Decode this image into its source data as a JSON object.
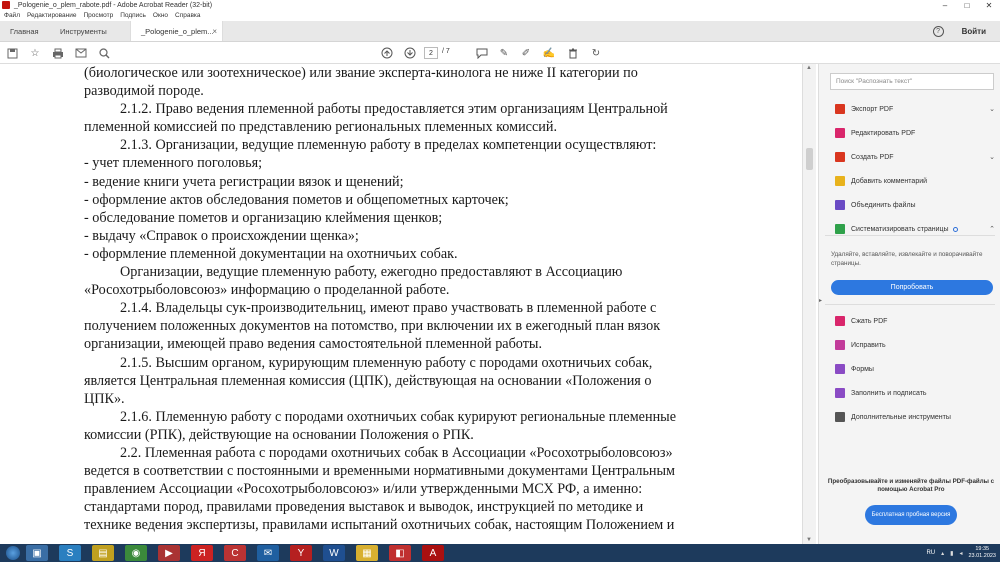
{
  "window": {
    "title": "_Pologenie_o_plem_rabote.pdf - Adobe Acrobat Reader (32-bit)",
    "controls": [
      "–",
      "□",
      "✕"
    ]
  },
  "menu": [
    "Файл",
    "Редактирование",
    "Просмотр",
    "Подпись",
    "Окно",
    "Справка"
  ],
  "tabs": {
    "home": "Главная",
    "tools": "Инструменты",
    "document": "_Pologenie_o_plem...",
    "sign_in": "Войти",
    "help": "?"
  },
  "toolbar": {
    "current_page": "2",
    "total_pages": "/ 7"
  },
  "document": {
    "lines": [
      {
        "text": "(биологическое или зоотехническое) или звание эксперта-кинолога не ниже II категории по",
        "style": "j"
      },
      {
        "text": "разводимой породе.",
        "style": ""
      },
      {
        "text": "2.1.2. Право ведения племенной работы предоставляется этим организациям Центральной",
        "style": "j ind"
      },
      {
        "text": "племенной комиссией по представлению региональных племенных комиссий.",
        "style": ""
      },
      {
        "text": "2.1.3. Организации, ведущие племенную работу в пределах компетенции осуществляют:",
        "style": "ind"
      },
      {
        "text": "- учет племенного поголовья;",
        "style": ""
      },
      {
        "text": "- ведение книги учета регистрации вязок и щенений;",
        "style": ""
      },
      {
        "text": "- оформление актов обследования пометов и общепометных карточек;",
        "style": ""
      },
      {
        "text": "- обследование пометов и организацию клеймения щенков;",
        "style": ""
      },
      {
        "text": "- выдачу «Справок о происхождении щенка»;",
        "style": ""
      },
      {
        "text": "- оформление племенной документации на охотничьих собак.",
        "style": ""
      },
      {
        "text": "Организации, ведущие племенную работу, ежегодно предоставляют в Ассоциацию",
        "style": "j ind"
      },
      {
        "text": "«Росохотрыболовсоюз» информацию о проделанной работе.",
        "style": ""
      },
      {
        "text": "2.1.4. Владельцы сук-производительниц, имеют право участвовать в племенной работе с",
        "style": "j ind"
      },
      {
        "text": "получением положенных документов на потомство, при включении их в ежегодный план вязок",
        "style": "j"
      },
      {
        "text": "организации, имеющей право ведения самостоятельной племенной работы.",
        "style": ""
      },
      {
        "text": "2.1.5. Высшим органом, курирующим племенную работу с породами охотничьих собак,",
        "style": "j ind"
      },
      {
        "text": "является Центральная племенная комиссия (ЦПК), действующая на основании «Положения о",
        "style": "j"
      },
      {
        "text": "ЦПК».",
        "style": ""
      },
      {
        "text": "2.1.6. Племенную работу с породами охотничьих собак курируют региональные племенные",
        "style": "j ind"
      },
      {
        "text": "комиссии (РПК), действующие на основании Положения о РПК.",
        "style": ""
      },
      {
        "text": "2.2. Племенная работа с породами охотничьих собак в Ассоциации «Росохотрыболовсоюз»",
        "style": "j ind"
      },
      {
        "text": "ведется в соответствии с постоянными и временными нормативными документами Центральным",
        "style": "j"
      },
      {
        "text": "правлением Ассоциации «Росохотрыболовсоюз» и/или утвержденными МСХ РФ, а именно:",
        "style": "j"
      },
      {
        "text": "стандартами пород, правилами проведения выставок и выводок, инструкцией по методике и",
        "style": "j"
      },
      {
        "text": "технике ведения экспертизы, правилами испытаний охотничьих собак, настоящим Положением и",
        "style": "j"
      }
    ]
  },
  "right_pane": {
    "search_placeholder": "Поиск \"Распознать текст\"",
    "tools": [
      {
        "label": "Экспорт PDF",
        "icon": "export-pdf-icon",
        "color": "#d9361f",
        "chevron": true
      },
      {
        "label": "Редактировать PDF",
        "icon": "edit-pdf-icon",
        "color": "#d9266b",
        "chevron": false
      },
      {
        "label": "Создать PDF",
        "icon": "create-pdf-icon",
        "color": "#d9361f",
        "chevron": true
      },
      {
        "label": "Добавить комментарий",
        "icon": "comment-icon",
        "color": "#e8b21c",
        "chevron": false
      },
      {
        "label": "Объединить файлы",
        "icon": "combine-files-icon",
        "color": "#6a4bc4",
        "chevron": false
      },
      {
        "label": "Систематизировать страницы",
        "icon": "organize-pages-icon",
        "color": "#2fa14a",
        "chevron": true
      }
    ],
    "organize_desc": "Удаляйте, вставляйте, извлекайте и поворачивайте страницы.",
    "try_button": "Попробовать",
    "tools2": [
      {
        "label": "Сжать PDF",
        "icon": "compress-pdf-icon",
        "color": "#d9266b"
      },
      {
        "label": "Исправить",
        "icon": "fix-icon",
        "color": "#c23b9a"
      },
      {
        "label": "Формы",
        "icon": "forms-icon",
        "color": "#8a4bc4"
      },
      {
        "label": "Заполнить и подписать",
        "icon": "fill-sign-icon",
        "color": "#8a4bc4"
      },
      {
        "label": "Дополнительные инструменты",
        "icon": "more-tools-icon",
        "color": "#555555"
      }
    ],
    "promo_text": "Преобразовывайте и изменяйте файлы PDF-файлы с помощью Acrobat Pro",
    "trial_button": "Бесплатная пробная версия"
  },
  "taskbar": {
    "language": "RU",
    "time": "19:35",
    "date": "23.01.2023"
  }
}
